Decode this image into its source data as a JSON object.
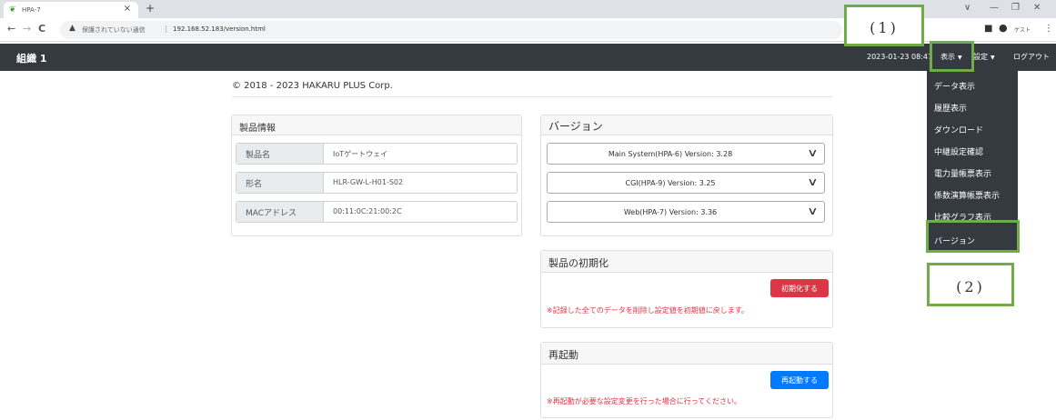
{
  "browser": {
    "tab_title": "HPA-7",
    "tab_close": "×",
    "new_tab": "+",
    "back": "←",
    "forward": "→",
    "reload": "C",
    "insecure_label": "保護されていない通信",
    "url": "192.168.52.183/version.html",
    "guest_label": "ゲスト",
    "win_down": "∨",
    "win_min": "—",
    "win_restore": "❐",
    "win_close": "✕"
  },
  "navbar": {
    "brand": "組織 1",
    "datetime": "2023-01-23 08:47",
    "display_menu": "表示",
    "settings_menu": "設定",
    "logout": "ログアウト"
  },
  "dropdown": {
    "items": [
      {
        "label": "データ表示"
      },
      {
        "label": "履歴表示"
      },
      {
        "label": "ダウンロード"
      },
      {
        "label": "中継設定確認"
      },
      {
        "label": "電力量帳票表示"
      },
      {
        "label": "係数演算帳票表示"
      },
      {
        "label": "比較グラフ表示"
      },
      {
        "label": "バージョン"
      }
    ]
  },
  "annotations": {
    "label1": "(1)",
    "label2": "(2)",
    "color": "#70ad47"
  },
  "content": {
    "copyright": "© 2018 - 2023 HAKARU PLUS Corp.",
    "product_info": {
      "title": "製品情報",
      "rows": [
        {
          "label": "製品名",
          "value": "IoTゲートウェイ"
        },
        {
          "label": "形名",
          "value": "HLR-GW-L-H01-S02"
        },
        {
          "label": "MACアドレス",
          "value": "00:11:0C:21:00:2C"
        }
      ]
    },
    "version": {
      "title": "バージョン",
      "items": [
        {
          "label": "Main System(HPA-6) Version: 3.28"
        },
        {
          "label": "CGI(HPA-9) Version: 3.25"
        },
        {
          "label": "Web(HPA-7) Version: 3.36"
        }
      ]
    },
    "init": {
      "title": "製品の初期化",
      "button": "初期化する",
      "note": "※記録した全てのデータを削除し設定値を初期値に戻します。"
    },
    "restart": {
      "title": "再起動",
      "button": "再起動する",
      "note": "※再起動が必要な設定変更を行った場合に行ってください。"
    }
  }
}
